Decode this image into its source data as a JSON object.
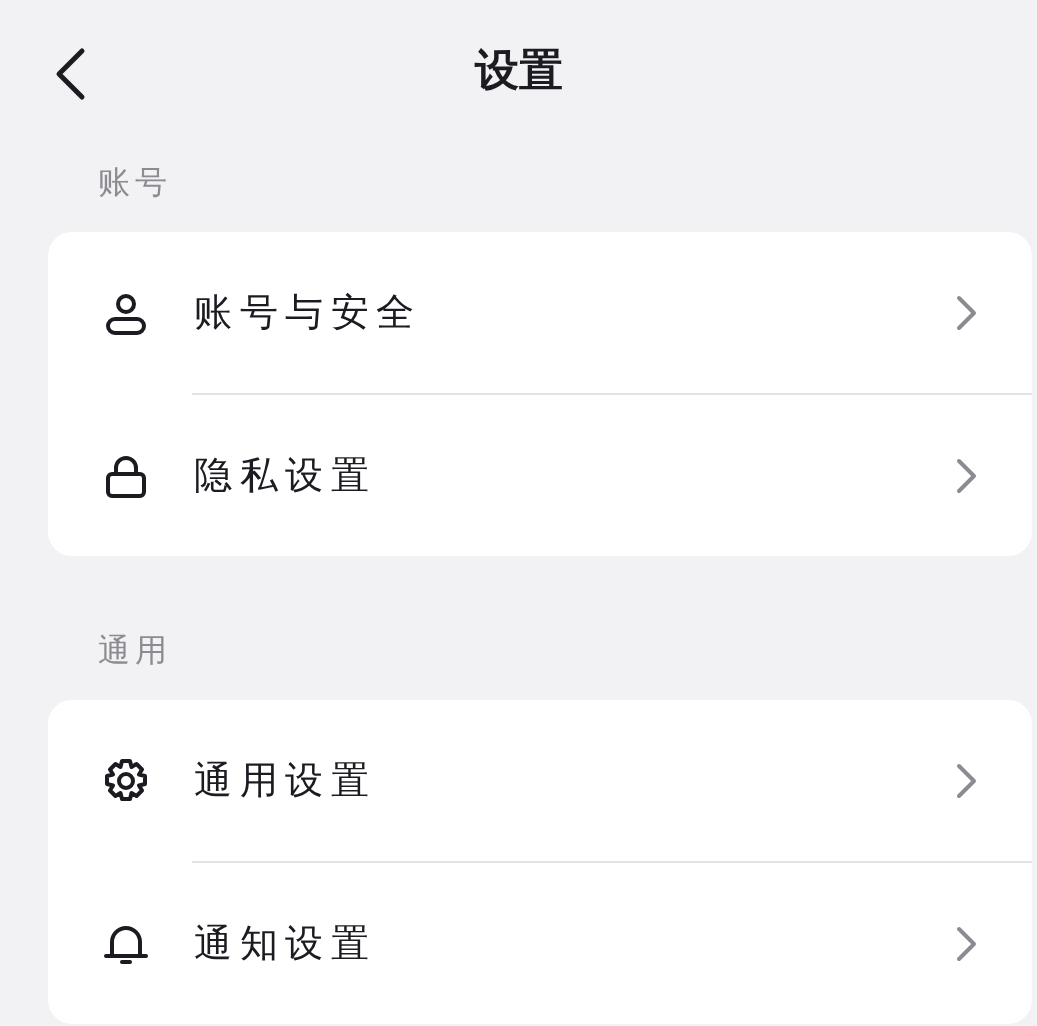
{
  "title": "设置",
  "sections": [
    {
      "header": "账号",
      "items": [
        {
          "label": "账号与安全"
        },
        {
          "label": "隐私设置"
        }
      ]
    },
    {
      "header": "通用",
      "items": [
        {
          "label": "通用设置"
        },
        {
          "label": "通知设置"
        }
      ]
    }
  ]
}
